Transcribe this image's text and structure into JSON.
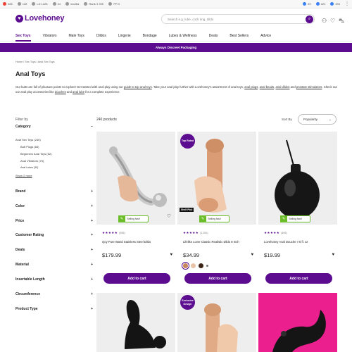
{
  "seo_toolbar": {
    "items": [
      {
        "icon": "google-icon",
        "value": "456",
        "color": "#ea4335"
      },
      {
        "icon": "backlink-icon",
        "value": "128",
        "color": "#888888"
      },
      {
        "icon": "pages-icon",
        "value": "LD 1228",
        "color": "#888888"
      },
      {
        "icon": "rank-icon",
        "value": "34",
        "color": "#888888"
      },
      {
        "icon": "index-icon",
        "value": "mozilla",
        "color": "#888888"
      },
      {
        "icon": "flag-icon",
        "value": "Rank 3.78K",
        "color": "#888888"
      },
      {
        "icon": "pr-icon",
        "value": "PR 0",
        "color": "#888888"
      }
    ],
    "right_items": [
      {
        "value": "39"
      },
      {
        "value": "322"
      },
      {
        "value": "394"
      }
    ]
  },
  "header": {
    "logo_text": "Lovehoney",
    "search_placeholder": "Search e.g. lube, cock ring, dildo",
    "brand_color": "#5b0c8f"
  },
  "nav": {
    "items": [
      {
        "label": "Sex Toys",
        "active": true
      },
      {
        "label": "Vibrators"
      },
      {
        "label": "Male Toys"
      },
      {
        "label": "Dildos"
      },
      {
        "label": "Lingerie"
      },
      {
        "label": "Bondage"
      },
      {
        "label": "Lubes & Wellness"
      },
      {
        "label": "Deals"
      },
      {
        "label": "Best Sellers"
      },
      {
        "label": "Advice"
      }
    ]
  },
  "banner": {
    "text": "Always Discreet Packaging"
  },
  "breadcrumb": {
    "text": "Home / Sex Toys / Anal Sex Toys"
  },
  "page": {
    "title": "Anal Toys",
    "intro_1": "Our butts are full of pleasure points to explore! Get started with anal play using our ",
    "intro_link_1": "guide to top anal toys",
    "intro_2": ". Take your anal play further with Lovehoney's assortment of anal toys, ",
    "intro_link_2": "anal plugs",
    "intro_3": ", ",
    "intro_link_3": "anal beads",
    "intro_4": ", ",
    "intro_link_4": "anal dildos",
    "intro_5": " and ",
    "intro_link_5": "prostate stimulators",
    "intro_6": ". Check out our anal play accessories like ",
    "intro_link_6": "douches",
    "intro_7": " and ",
    "intro_link_7": "anal lube",
    "intro_8": " for a complete experience."
  },
  "filters": {
    "title": "Filter by",
    "category_label": "Category",
    "category_items": [
      "Anal Sex Toys (240)",
      "Butt Plugs (84)",
      "Beginners Anal Toys (62)",
      "Anal Vibrators (75)",
      "Anal Lubes (30)"
    ],
    "show_more": "Show 2 more",
    "facets": [
      "Brand",
      "Color",
      "Price",
      "Customer Rating",
      "Deals",
      "Material",
      "Insertable Length",
      "Circumference",
      "Product Type"
    ]
  },
  "results": {
    "count": "240 products",
    "sort_label": "Sort By",
    "sort_value": "Popularity"
  },
  "products": [
    {
      "title": "njoy Pure Wand Stainless Steel Dildo",
      "stars": "★★★★★",
      "reviews": "(395)",
      "price": "$179.99",
      "badge": "",
      "fast_label": "Selling fast!",
      "cta": "Add to cart"
    },
    {
      "title": "Lifelike Lover Classic Realistic Dildo 8 Inch",
      "stars": "★★★★★",
      "reviews": "(1,351)",
      "price": "$34.99",
      "badge": "Top Rated",
      "shelf": "Shelf Pick",
      "fast_label": "Selling fast!",
      "swatches": [
        "#c8865b",
        "#e9c3a8",
        "#3b2416"
      ],
      "cta": "Add to cart"
    },
    {
      "title": "Lovehoney Anal Douche 7.6 fl. oz",
      "stars": "★★★★★",
      "reviews": "(409)",
      "price": "$19.99",
      "badge": "",
      "fast_label": "Selling fast!",
      "cta": "Add to cart"
    }
  ],
  "products_row2": [
    {
      "badge": ""
    },
    {
      "badge": "Exclusive Design"
    },
    {
      "badge": ""
    }
  ]
}
